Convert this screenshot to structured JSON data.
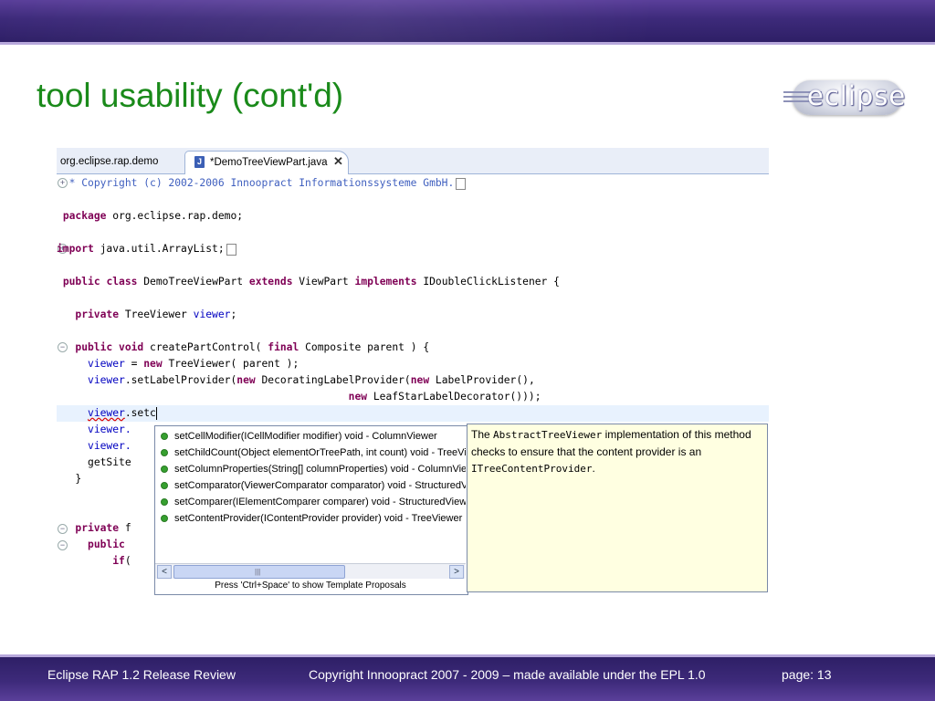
{
  "slide": {
    "title": "tool usability (cont'd)",
    "logo_text": "eclipse"
  },
  "ide": {
    "tabs": [
      {
        "label": "org.eclipse.rap.demo",
        "active": false
      },
      {
        "label": "*DemoTreeViewPart.java",
        "active": true,
        "icon": "java-file-icon",
        "close": "✕"
      }
    ]
  },
  "code_lines": {
    "l1": "* Copyright (c) 2002-2006 Innoopract Informationssysteme GmbH.",
    "l2_kw": "package",
    "l2_rest": " org.eclipse.rap.demo;",
    "l3_kw": "import",
    "l3_rest": " java.util.ArrayList;",
    "l4_kw1": "public",
    "l4_kw2": "class",
    "l4_name": " DemoTreeViewPart ",
    "l4_kw3": "extends",
    "l4_mid": " ViewPart ",
    "l4_kw4": "implements",
    "l4_end": " IDoubleClickListener {",
    "l5_kw": "private",
    "l5_type": " TreeViewer ",
    "l5_fld": "viewer",
    "l5_end": ";",
    "l6_kw1": "public",
    "l6_kw2": "void",
    "l6_mid": " createPartControl( ",
    "l6_kw3": "final",
    "l6_end": " Composite parent ) {",
    "l7_fld": "viewer",
    "l7_mid": " = ",
    "l7_kw": "new",
    "l7_end": " TreeViewer( parent );",
    "l8_fld": "viewer",
    "l8_mid": ".setLabelProvider(",
    "l8_kw": "new",
    "l8_mid2": " DecoratingLabelProvider(",
    "l8_kw2": "new",
    "l8_end": " LabelProvider(),",
    "l9_kw": "new",
    "l9_end": " LeafStarLabelDecorator()));",
    "l10_fld": "viewer",
    "l10_end": ".setc",
    "l11": "viewer.",
    "l12": "viewer.",
    "l13": "getSite",
    "l14": "}",
    "l15_kw": "private",
    "l15_end": " f",
    "l16_kw": "public",
    "l17_kw": "if",
    "l17_end": "("
  },
  "assist": {
    "items": [
      "setCellModifier(ICellModifier modifier)  void - ColumnViewer",
      "setChildCount(Object elementOrTreePath, int count)  void - TreeViewer",
      "setColumnProperties(String[] columnProperties)  void - ColumnViewer",
      "setComparator(ViewerComparator comparator)  void - StructuredViewer",
      "setComparer(IElementComparer comparer)  void - StructuredViewer",
      "setContentProvider(IContentProvider provider)  void - TreeViewer"
    ],
    "footer": "Press 'Ctrl+Space' to show Template Proposals",
    "scroll_left": "<",
    "scroll_right": ">",
    "scroll_grip": "|||"
  },
  "doc": {
    "p1": "The ",
    "p2": "AbstractTreeViewer",
    "p3": " implementation of this method checks to ensure that the content provider is an ",
    "p4": "ITreeContentProvider",
    "p5": "."
  },
  "footer": {
    "left": "Eclipse RAP 1.2 Release Review",
    "center": "Copyright Innoopract 2007 - 2009  – made available under the EPL 1.0",
    "right": "page: 13"
  },
  "colors": {
    "title": "#1a8a1a",
    "keyword": "#7f0055",
    "field": "#0000c0",
    "comment": "#3f5fbf",
    "banner": "#3d2a7a"
  }
}
